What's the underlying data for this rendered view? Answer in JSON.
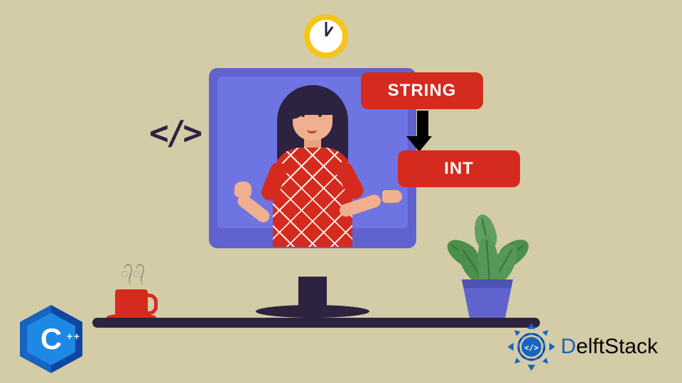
{
  "diagram": {
    "topic": "String to Int conversion",
    "labels": {
      "string": "STRING",
      "int": "INT"
    },
    "code_icon_glyph": "</>",
    "clock_time_approx": "8:00"
  },
  "badges": {
    "language": "C",
    "language_suffix": "++"
  },
  "brand": {
    "name": "DelftStack",
    "logo_code_glyph": "</>"
  },
  "colors": {
    "background": "#d4cba7",
    "accent_red": "#d52b1e",
    "monitor_purple": "#6063ce",
    "dark": "#2d2340",
    "cpp_blue": "#1565c0"
  }
}
